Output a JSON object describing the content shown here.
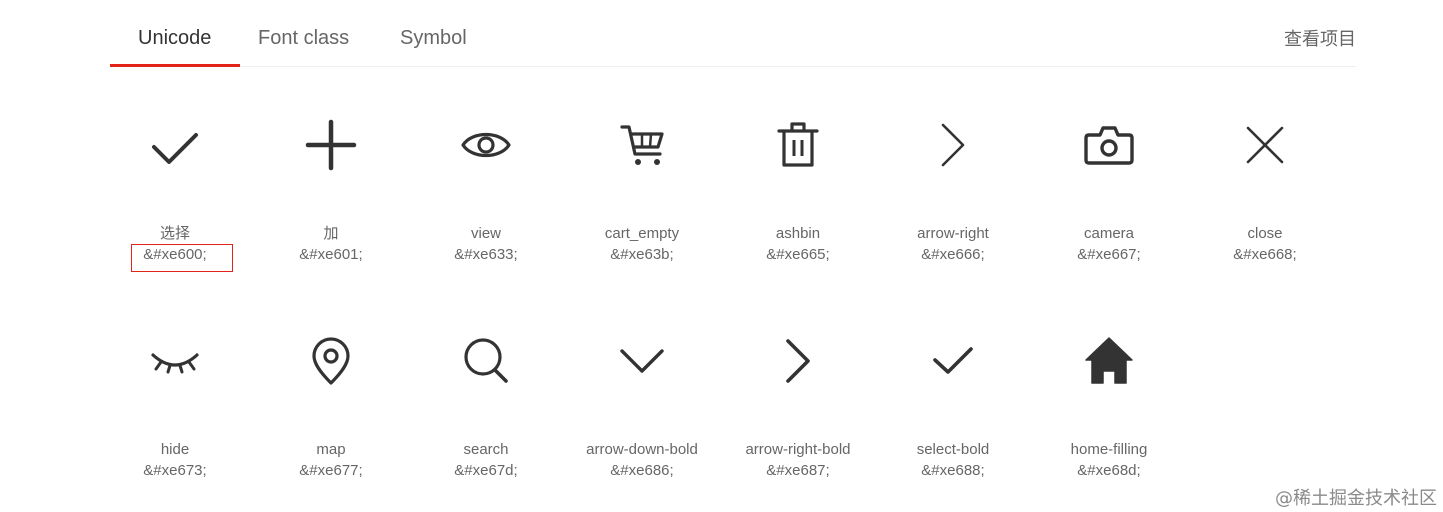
{
  "tabs": [
    {
      "label": "Unicode",
      "active": true
    },
    {
      "label": "Font class",
      "active": false
    },
    {
      "label": "Symbol",
      "active": false
    }
  ],
  "header": {
    "view_project_label": "查看项目"
  },
  "accent_color": "#e2231a",
  "icons": [
    {
      "name": "选择",
      "code": "&#xe600;",
      "icon": "check-icon"
    },
    {
      "name": "加",
      "code": "&#xe601;",
      "icon": "plus-icon"
    },
    {
      "name": "view",
      "code": "&#xe633;",
      "icon": "eye-icon"
    },
    {
      "name": "cart_empty",
      "code": "&#xe63b;",
      "icon": "cart-icon"
    },
    {
      "name": "ashbin",
      "code": "&#xe665;",
      "icon": "trash-icon"
    },
    {
      "name": "arrow-right",
      "code": "&#xe666;",
      "icon": "arrow-right-icon"
    },
    {
      "name": "camera",
      "code": "&#xe667;",
      "icon": "camera-icon"
    },
    {
      "name": "close",
      "code": "&#xe668;",
      "icon": "close-icon"
    },
    {
      "name": "hide",
      "code": "&#xe673;",
      "icon": "eye-closed-icon"
    },
    {
      "name": "map",
      "code": "&#xe677;",
      "icon": "map-pin-icon"
    },
    {
      "name": "search",
      "code": "&#xe67d;",
      "icon": "search-icon"
    },
    {
      "name": "arrow-down-bold",
      "code": "&#xe686;",
      "icon": "chevron-down-icon"
    },
    {
      "name": "arrow-right-bold",
      "code": "&#xe687;",
      "icon": "chevron-right-bold-icon"
    },
    {
      "name": "select-bold",
      "code": "&#xe688;",
      "icon": "check-bold-icon"
    },
    {
      "name": "home-filling",
      "code": "&#xe68d;",
      "icon": "home-filled-icon"
    }
  ],
  "watermark": "@稀土掘金技术社区"
}
